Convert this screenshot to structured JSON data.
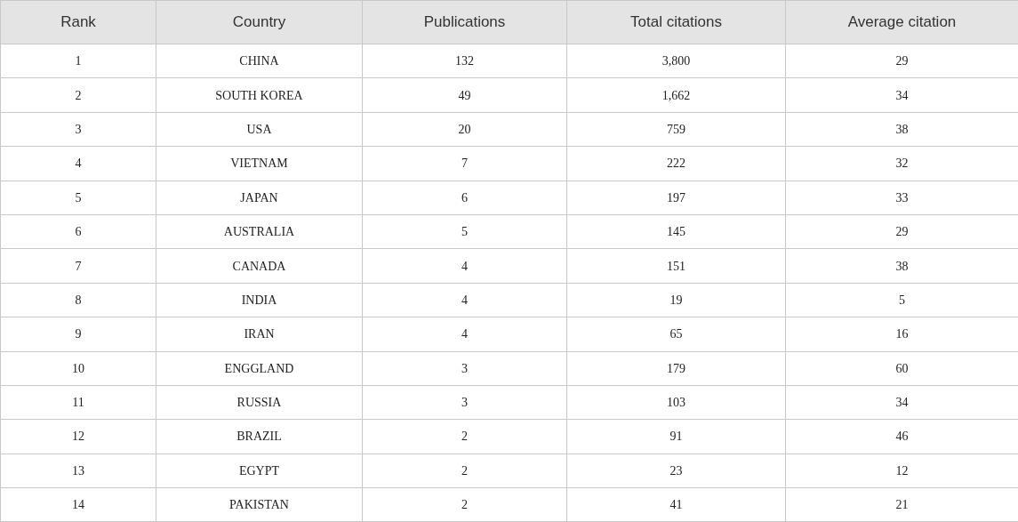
{
  "table": {
    "columns": [
      "Rank",
      "Country",
      "Publications",
      "Total citations",
      "Average citation"
    ],
    "rows": [
      [
        "1",
        "CHINA",
        "132",
        "3,800",
        "29"
      ],
      [
        "2",
        "SOUTH KOREA",
        "49",
        "1,662",
        "34"
      ],
      [
        "3",
        "USA",
        "20",
        "759",
        "38"
      ],
      [
        "4",
        "VIETNAM",
        "7",
        "222",
        "32"
      ],
      [
        "5",
        "JAPAN",
        "6",
        "197",
        "33"
      ],
      [
        "6",
        "AUSTRALIA",
        "5",
        "145",
        "29"
      ],
      [
        "7",
        "CANADA",
        "4",
        "151",
        "38"
      ],
      [
        "8",
        "INDIA",
        "4",
        "19",
        "5"
      ],
      [
        "9",
        "IRAN",
        "4",
        "65",
        "16"
      ],
      [
        "10",
        "ENGGLAND",
        "3",
        "179",
        "60"
      ],
      [
        "11",
        "RUSSIA",
        "3",
        "103",
        "34"
      ],
      [
        "12",
        "BRAZIL",
        "2",
        "91",
        "46"
      ],
      [
        "13",
        "EGYPT",
        "2",
        "23",
        "12"
      ],
      [
        "14",
        "PAKISTAN",
        "2",
        "41",
        "21"
      ]
    ]
  }
}
